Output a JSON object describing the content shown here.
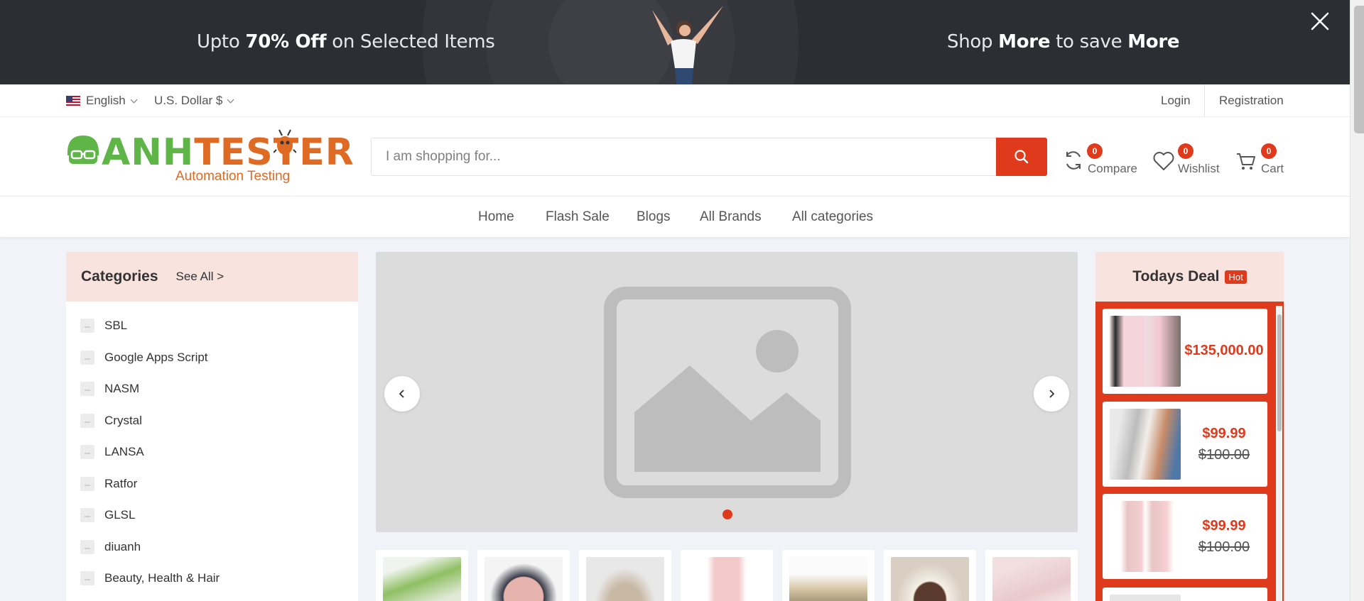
{
  "promo": {
    "left_text_pre": "Upto ",
    "left_text_bold": "70% Off",
    "left_text_post": " on Selected Items",
    "right_text_pre": "Shop ",
    "right_text_bold1": "More",
    "right_text_mid": " to save ",
    "right_text_bold2": "More"
  },
  "topbar": {
    "language": "English",
    "currency": "U.S. Dollar $",
    "login": "Login",
    "registration": "Registration"
  },
  "header": {
    "logo_word_green": "ANH",
    "logo_word_orange": "TESTER",
    "logo_sub": "Automation Testing",
    "search_placeholder": "I am shopping for...",
    "compare_label": "Compare",
    "compare_count": "0",
    "wishlist_label": "Wishlist",
    "wishlist_count": "0",
    "cart_label": "Cart",
    "cart_count": "0"
  },
  "nav": {
    "items": [
      "Home",
      "Flash Sale",
      "Blogs",
      "All Brands",
      "All categories"
    ]
  },
  "categories": {
    "title": "Categories",
    "see_all": "See All >",
    "items": [
      "SBL",
      "Google Apps Script",
      "NASM",
      "Crystal",
      "LANSA",
      "Ratfor",
      "GLSL",
      "diuanh",
      "Beauty, Health & Hair"
    ]
  },
  "deal": {
    "title": "Todays Deal",
    "badge": "Hot",
    "products": [
      {
        "price": "$135,000.00",
        "old_price": ""
      },
      {
        "price": "$99.99",
        "old_price": "$100.00"
      },
      {
        "price": "$99.99",
        "old_price": "$100.00"
      }
    ]
  },
  "colors": {
    "accent": "#e03a1c",
    "brand_green": "#5fb548",
    "brand_orange": "#df6a23",
    "promo_bg": "#2c2e33",
    "panel_pink": "#f9e3df"
  }
}
